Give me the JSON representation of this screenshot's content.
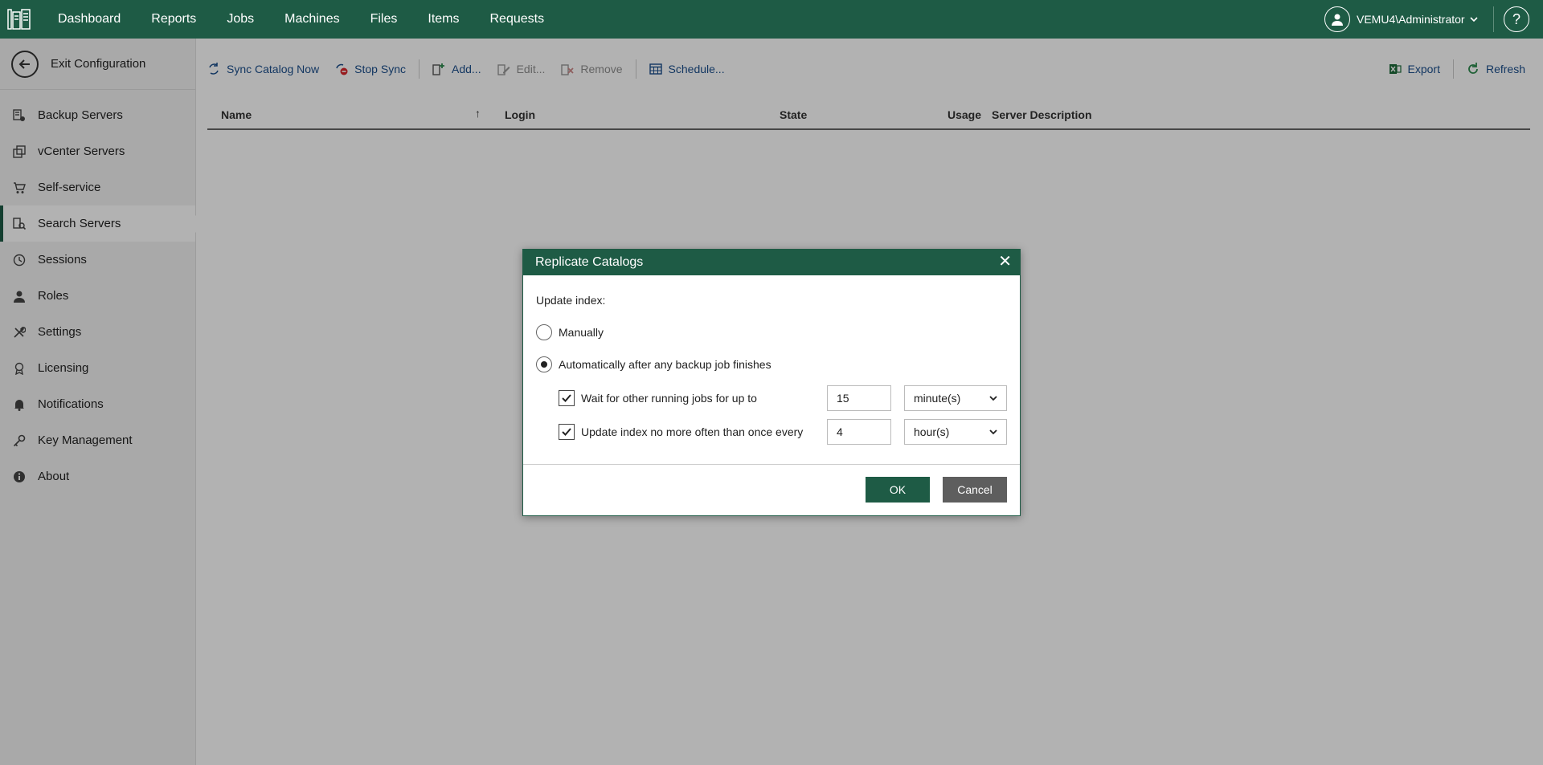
{
  "nav": {
    "items": [
      "Dashboard",
      "Reports",
      "Jobs",
      "Machines",
      "Files",
      "Items",
      "Requests"
    ]
  },
  "user": {
    "name": "VEMU4\\Administrator"
  },
  "help": {
    "label": "?"
  },
  "sidebar": {
    "exit_label": "Exit Configuration",
    "items": [
      {
        "label": "Backup Servers",
        "icon": "backup-servers-icon"
      },
      {
        "label": "vCenter Servers",
        "icon": "vcenter-icon"
      },
      {
        "label": "Self-service",
        "icon": "cart-icon"
      },
      {
        "label": "Search Servers",
        "icon": "search-servers-icon",
        "active": true
      },
      {
        "label": "Sessions",
        "icon": "clock-icon"
      },
      {
        "label": "Roles",
        "icon": "user-icon"
      },
      {
        "label": "Settings",
        "icon": "tools-icon"
      },
      {
        "label": "Licensing",
        "icon": "license-icon"
      },
      {
        "label": "Notifications",
        "icon": "bell-icon"
      },
      {
        "label": "Key Management",
        "icon": "key-icon"
      },
      {
        "label": "About",
        "icon": "info-icon"
      }
    ]
  },
  "toolbar": {
    "sync_now": "Sync Catalog Now",
    "stop_sync": "Stop Sync",
    "add": "Add...",
    "edit": "Edit...",
    "remove": "Remove",
    "schedule": "Schedule...",
    "export": "Export",
    "refresh": "Refresh"
  },
  "table": {
    "columns": [
      "Name",
      "Login",
      "State",
      "Usage",
      "Server Description"
    ],
    "sort_indicator": "↑"
  },
  "dialog": {
    "title": "Replicate Catalogs",
    "update_index_label": "Update index:",
    "option_manually": "Manually",
    "option_auto": "Automatically after any backup job finishes",
    "wait_label": "Wait for other running jobs for up to",
    "wait_value": "15",
    "wait_unit": "minute(s)",
    "limit_label": "Update index no more often than once every",
    "limit_value": "4",
    "limit_unit": "hour(s)",
    "ok": "OK",
    "cancel": "Cancel",
    "close": "✕"
  },
  "colors": {
    "brand": "#1e5b45",
    "link": "#1a4e8c",
    "cancel_button": "#5e5e5e"
  }
}
